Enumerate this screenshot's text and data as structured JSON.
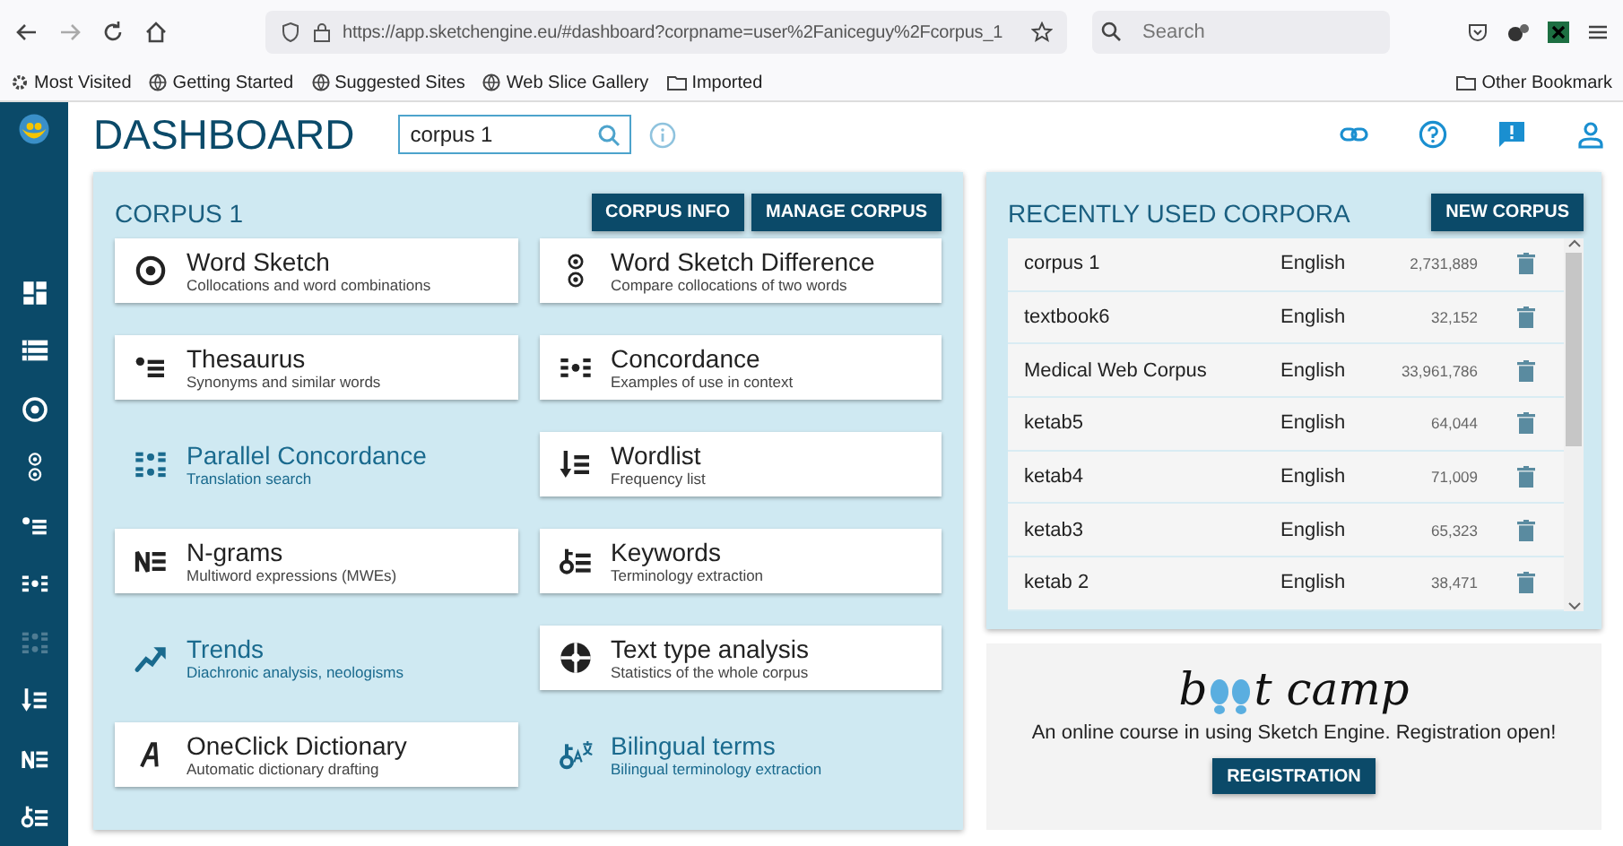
{
  "browser": {
    "url": "https://app.sketchengine.eu/#dashboard?corpname=user%2Faniceguy%2Fcorpus_1",
    "search": {
      "placeholder": "Search"
    },
    "bookmarks": [
      {
        "kind": "gear",
        "label": "Most Visited"
      },
      {
        "kind": "globe",
        "label": "Getting Started"
      },
      {
        "kind": "globe",
        "label": "Suggested Sites"
      },
      {
        "kind": "globe",
        "label": "Web Slice Gallery"
      },
      {
        "kind": "folder",
        "label": "Imported"
      }
    ],
    "other_bookmarks": "Other Bookmark"
  },
  "sidebar": {
    "items": [
      {
        "kind": "dashboard",
        "disabled": false
      },
      {
        "kind": "list",
        "disabled": false
      },
      {
        "kind": "target",
        "disabled": false
      },
      {
        "kind": "double-target",
        "disabled": false
      },
      {
        "kind": "thesaurus",
        "disabled": false
      },
      {
        "kind": "concordance",
        "disabled": false
      },
      {
        "kind": "parallel",
        "disabled": true
      },
      {
        "kind": "wordlist",
        "disabled": false
      },
      {
        "kind": "ngrams",
        "disabled": false
      },
      {
        "kind": "keywords",
        "disabled": false
      }
    ]
  },
  "header": {
    "title": "DASHBOARD",
    "search": {
      "value": "corpus 1"
    }
  },
  "corpus_panel": {
    "title": "CORPUS 1",
    "buttons": [
      "CORPUS INFO",
      "MANAGE CORPUS"
    ],
    "tools": [
      {
        "kind": "card",
        "title": "Word Sketch",
        "subtitle": "Collocations and word combinations"
      },
      {
        "kind": "card",
        "title": "Word Sketch Difference",
        "subtitle": "Compare collocations of two words"
      },
      {
        "kind": "card",
        "title": "Thesaurus",
        "subtitle": "Synonyms and similar words"
      },
      {
        "kind": "card",
        "title": "Concordance",
        "subtitle": "Examples of use in context"
      },
      {
        "kind": "plain",
        "title": "Parallel Concordance",
        "subtitle": "Translation search"
      },
      {
        "kind": "card",
        "title": "Wordlist",
        "subtitle": "Frequency list"
      },
      {
        "kind": "card",
        "title": "N-grams",
        "subtitle": "Multiword expressions (MWEs)"
      },
      {
        "kind": "card",
        "title": "Keywords",
        "subtitle": "Terminology extraction"
      },
      {
        "kind": "plain",
        "title": "Trends",
        "subtitle": "Diachronic analysis, neologisms"
      },
      {
        "kind": "card",
        "title": "Text type analysis",
        "subtitle": "Statistics of the whole corpus"
      },
      {
        "kind": "card",
        "title": "OneClick Dictionary",
        "subtitle": "Automatic dictionary drafting"
      },
      {
        "kind": "plain",
        "title": "Bilingual terms",
        "subtitle": "Bilingual terminology extraction"
      }
    ]
  },
  "recent": {
    "title": "RECENTLY USED CORPORA",
    "button": "NEW CORPUS",
    "rows": [
      {
        "name": "corpus 1",
        "language": "English",
        "size": "2,731,889"
      },
      {
        "name": "textbook6",
        "language": "English",
        "size": "32,152"
      },
      {
        "name": "Medical Web Corpus",
        "language": "English",
        "size": "33,961,786"
      },
      {
        "name": "ketab5",
        "language": "English",
        "size": "64,044"
      },
      {
        "name": "ketab4",
        "language": "English",
        "size": "71,009"
      },
      {
        "name": "ketab3",
        "language": "English",
        "size": "65,323"
      },
      {
        "name": "ketab 2",
        "language": "English",
        "size": "38,471"
      }
    ]
  },
  "bootcamp": {
    "logo_start": "b",
    "logo_end": "t camp",
    "text": "An online course in using Sketch Engine. Registration open!",
    "button": "REGISTRATION"
  }
}
